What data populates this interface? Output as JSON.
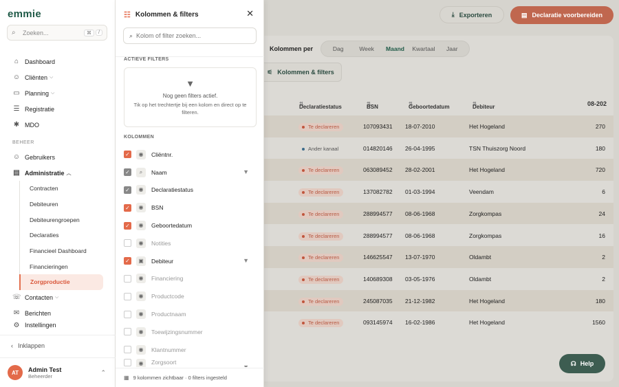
{
  "app": {
    "logo": "emmie"
  },
  "sidebar": {
    "search_placeholder": "Zoeken...",
    "search_kbd": [
      "⌘",
      "/"
    ],
    "items": [
      {
        "label": "Dashboard"
      },
      {
        "label": "Cliënten"
      },
      {
        "label": "Planning"
      },
      {
        "label": "Registratie"
      },
      {
        "label": "MDO"
      }
    ],
    "section_beheer": "BEHEER",
    "beheer_items": [
      {
        "label": "Gebruikers"
      },
      {
        "label": "Administratie"
      }
    ],
    "sub_items": [
      {
        "label": "Contracten"
      },
      {
        "label": "Debiteuren"
      },
      {
        "label": "Debiteurengroepen"
      },
      {
        "label": "Declaraties"
      },
      {
        "label": "Financieel Dashboard"
      },
      {
        "label": "Financieringen"
      },
      {
        "label": "Zorgproductie"
      }
    ],
    "after_items": [
      {
        "label": "Contacten"
      },
      {
        "label": "Berichten"
      },
      {
        "label": "Instellingen"
      }
    ],
    "collapse_label": "Inklappen",
    "user": {
      "initials": "AT",
      "name": "Admin Test",
      "role": "Beheerder"
    }
  },
  "toolbar": {
    "export_label": "Exporteren",
    "declare_label": "Declaratie voorbereiden",
    "period_label": "Kolommen per",
    "periods": [
      "Dag",
      "Week",
      "Maand",
      "Kwartaal",
      "Jaar"
    ],
    "period_selected": "Maand",
    "columns_filters_label": "Kolommen & filters"
  },
  "table": {
    "headers": [
      "Declaratiestatus",
      "BSN",
      "Geboortedatum",
      "Debiteur",
      "08-202"
    ],
    "rows": [
      {
        "status": "Te declareren",
        "bsn": "107093431",
        "dob": "18-07-2010",
        "debiteur": "Het Hogeland",
        "value": "270"
      },
      {
        "status": "Ander kanaal",
        "bsn": "014820146",
        "dob": "26-04-1995",
        "debiteur": "TSN Thuiszorg Noord",
        "value": "180"
      },
      {
        "status": "Te declareren",
        "bsn": "063089452",
        "dob": "28-02-2001",
        "debiteur": "Het Hogeland",
        "value": "720"
      },
      {
        "status": "Te declareren",
        "bsn": "137082782",
        "dob": "01-03-1994",
        "debiteur": "Veendam",
        "value": "6"
      },
      {
        "status": "Te declareren",
        "bsn": "288994577",
        "dob": "08-06-1968",
        "debiteur": "Zorgkompas",
        "value": "24"
      },
      {
        "status": "Te declareren",
        "bsn": "288994577",
        "dob": "08-06-1968",
        "debiteur": "Zorgkompas",
        "value": "16"
      },
      {
        "status": "Te declareren",
        "bsn": "146625547",
        "dob": "13-07-1970",
        "debiteur": "Oldambt",
        "value": "2"
      },
      {
        "status": "Te declareren",
        "bsn": "140689308",
        "dob": "03-05-1976",
        "debiteur": "Oldambt",
        "value": "2"
      },
      {
        "status": "Te declareren",
        "bsn": "245087035",
        "dob": "21-12-1982",
        "debiteur": "Het Hogeland",
        "value": "180"
      },
      {
        "status": "Te declareren",
        "bsn": "093145974",
        "dob": "16-02-1986",
        "debiteur": "Het Hogeland",
        "value": "1560"
      }
    ]
  },
  "help_label": "Help",
  "panel": {
    "title": "Kolommen & filters",
    "search_placeholder": "Kolom of filter zoeken...",
    "active_filters_label": "ACTIEVE FILTERS",
    "no_filters_title": "Nog geen filters actief.",
    "no_filters_text": "Tik op het trechtertje bij een kolom en direct op te filteren.",
    "columns_label": "KOLOMMEN",
    "columns": [
      {
        "name": "Cliëntnr.",
        "checked": true
      },
      {
        "name": "Naam",
        "checked": true
      },
      {
        "name": "Declaratiestatus",
        "checked": true
      },
      {
        "name": "BSN",
        "checked": true
      },
      {
        "name": "Geboortedatum",
        "checked": true
      },
      {
        "name": "Notities",
        "checked": false
      },
      {
        "name": "Debiteur",
        "checked": true
      },
      {
        "name": "Financiering",
        "checked": false
      },
      {
        "name": "Productcode",
        "checked": false
      },
      {
        "name": "Productnaam",
        "checked": false
      },
      {
        "name": "Toewijzingsnummer",
        "checked": false
      },
      {
        "name": "Klantnummer",
        "checked": false
      },
      {
        "name": "Zorgsoort",
        "checked": false
      }
    ],
    "footer": "9 kolommen zichtbaar · 0 filters ingesteld"
  },
  "colors": {
    "accent": "#e36a4a",
    "brand": "#1f5a47"
  }
}
